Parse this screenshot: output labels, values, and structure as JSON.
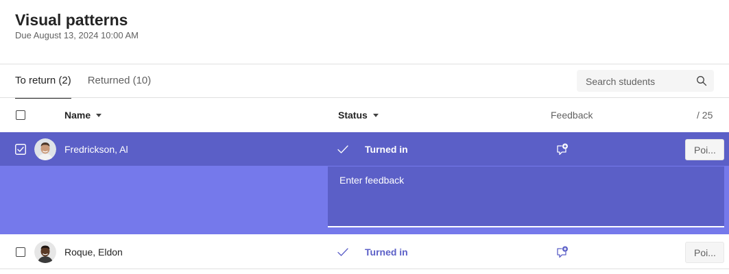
{
  "assignment": {
    "title": "Visual patterns",
    "due": "Due August 13, 2024 10:00 AM"
  },
  "tabs": [
    {
      "label": "To return (2)",
      "active": true
    },
    {
      "label": "Returned (10)",
      "active": false
    }
  ],
  "search": {
    "placeholder": "Search students",
    "icon": "search-icon"
  },
  "columns": {
    "name": "Name",
    "status": "Status",
    "feedback": "Feedback",
    "points": "/ 25"
  },
  "students": [
    {
      "name": "Fredrickson, Al",
      "status": "Turned in",
      "checked": true,
      "points_placeholder": "Poi...",
      "feedback_open": true
    },
    {
      "name": "Roque, Eldon",
      "status": "Turned in",
      "checked": false,
      "points_placeholder": "Poi...",
      "feedback_open": false
    }
  ],
  "feedback_editor": {
    "placeholder": "Enter feedback"
  },
  "colors": {
    "selected_row": "#5b5fc7",
    "expanded_panel": "#7579eb",
    "status_accent": "#5b5fc7"
  }
}
